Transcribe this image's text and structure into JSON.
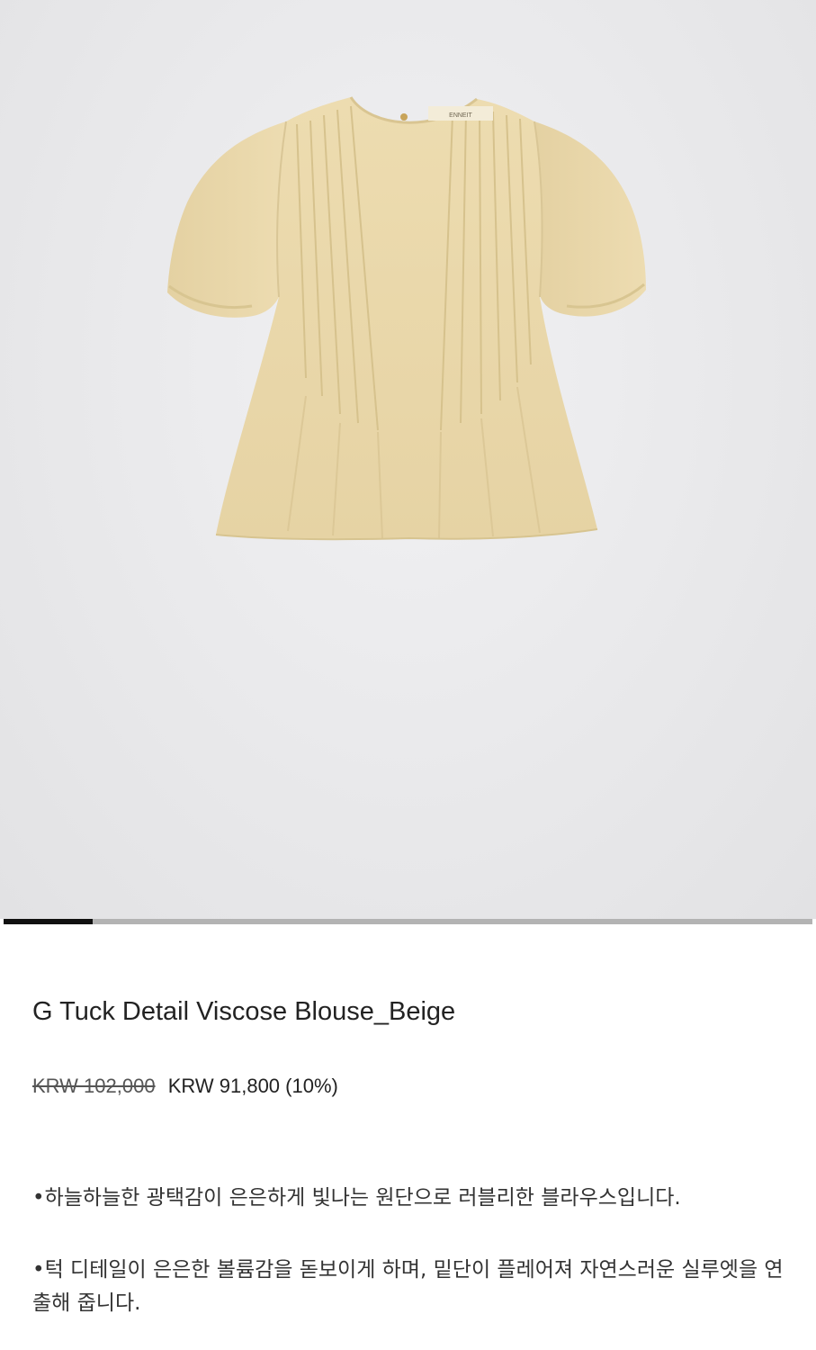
{
  "gallery": {
    "current_index": 1,
    "total_images": 9,
    "progress_fraction": 0.11,
    "product_color": "#ead9ad",
    "garment_label_text": "ENNEIT"
  },
  "product": {
    "name": "G Tuck Detail Viscose Blouse_Beige",
    "price_original": "KRW 102,000",
    "price_sale": "KRW 91,800 (10%)",
    "description": [
      "•하늘하늘한 광택감이 은은하게 빛나는 원단으로 러블리한 블라우스입니다.",
      "•턱 디테일이 은은한 볼륨감을 돋보이게 하며, 밑단이 플레어져 자연스러운 실루엣을 연출해 줍니다."
    ]
  }
}
